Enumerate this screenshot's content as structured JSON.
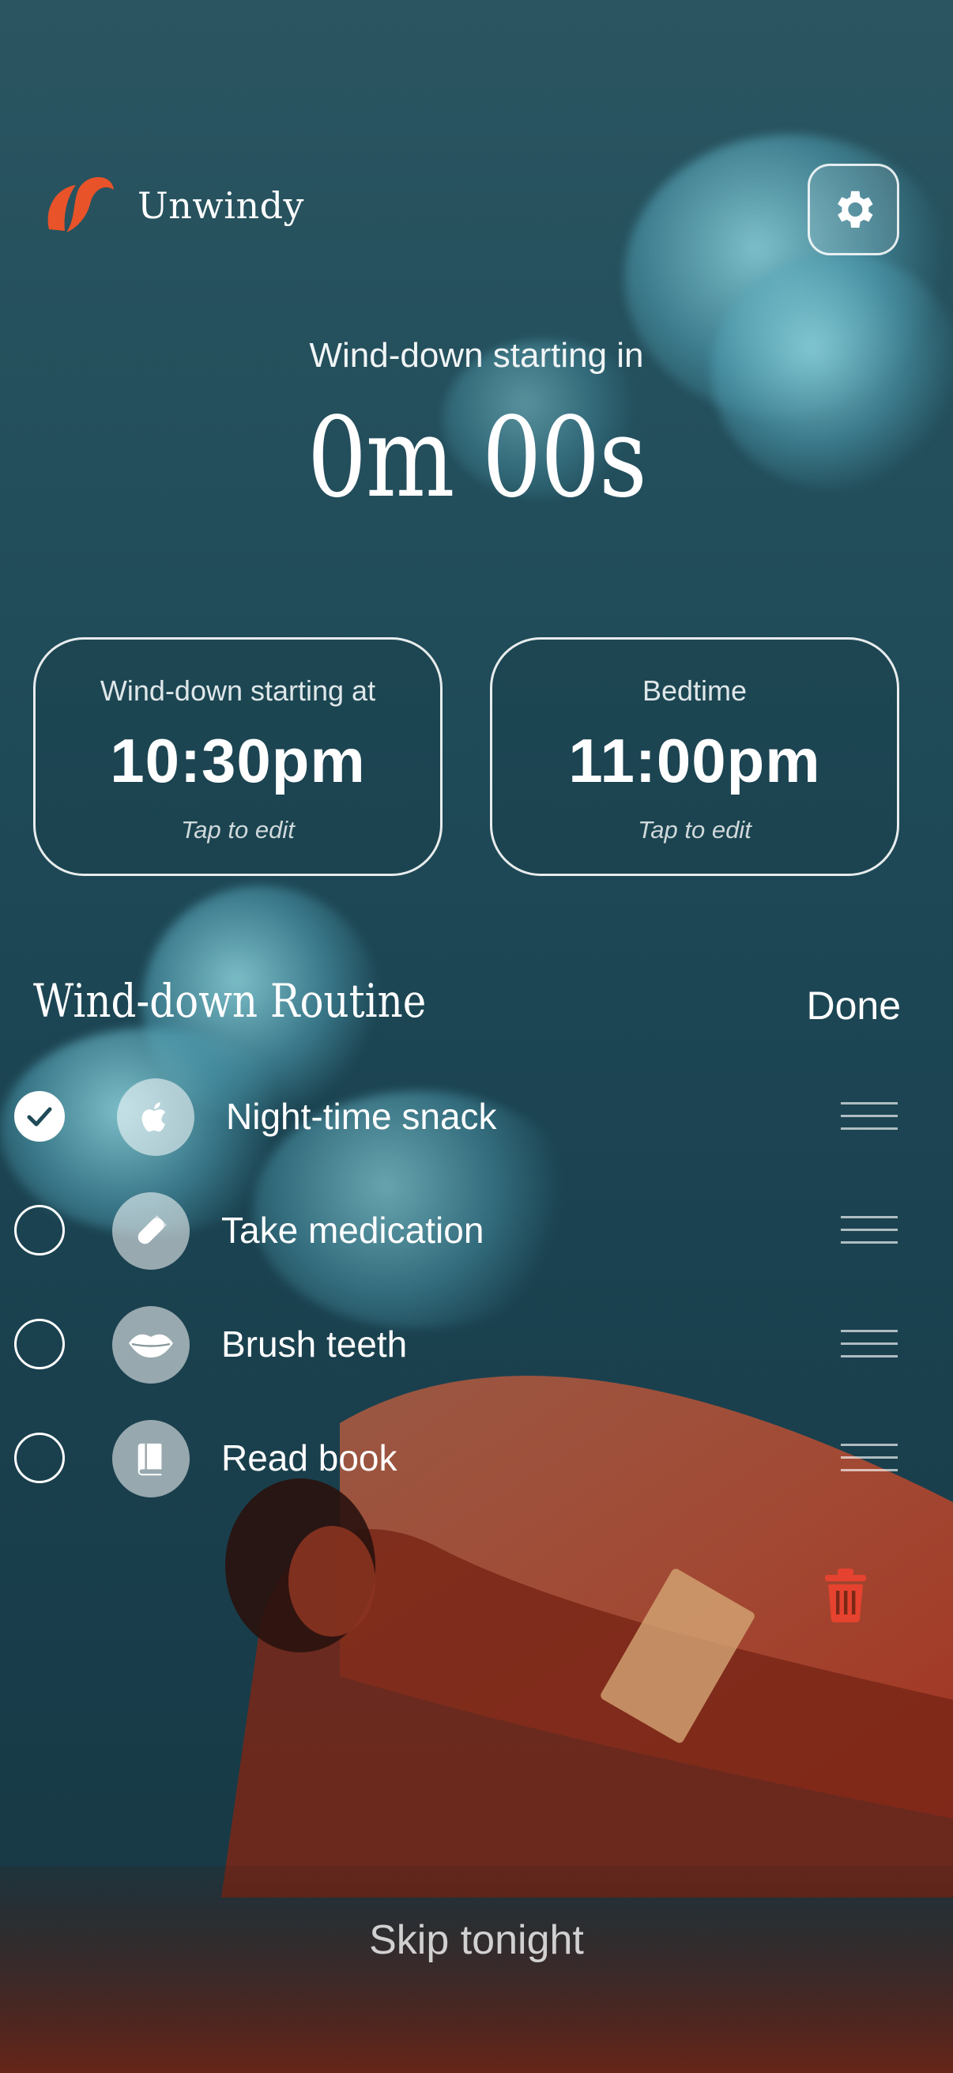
{
  "app": {
    "name": "Unwindy"
  },
  "header": {
    "settings_icon": "gear-icon"
  },
  "countdown": {
    "label": "Wind-down starting in",
    "value": "0m 00s"
  },
  "cards": [
    {
      "label": "Wind-down starting at",
      "value": "10:30pm",
      "hint": "Tap to edit"
    },
    {
      "label": "Bedtime",
      "value": "11:00pm",
      "hint": "Tap to edit"
    }
  ],
  "routine": {
    "title": "Wind-down Routine",
    "done_label": "Done",
    "items": [
      {
        "label": "Night-time snack",
        "icon": "apple-icon",
        "checked": true
      },
      {
        "label": "Take medication",
        "icon": "pill-icon",
        "checked": false
      },
      {
        "label": "Brush teeth",
        "icon": "lips-icon",
        "checked": false
      },
      {
        "label": "Read book",
        "icon": "book-icon",
        "checked": false
      }
    ],
    "delete_icon": "trash-icon"
  },
  "footer": {
    "skip_label": "Skip tonight"
  },
  "colors": {
    "accent": "#e8532a",
    "delete": "#e5432f",
    "background": "#1f4a58"
  }
}
